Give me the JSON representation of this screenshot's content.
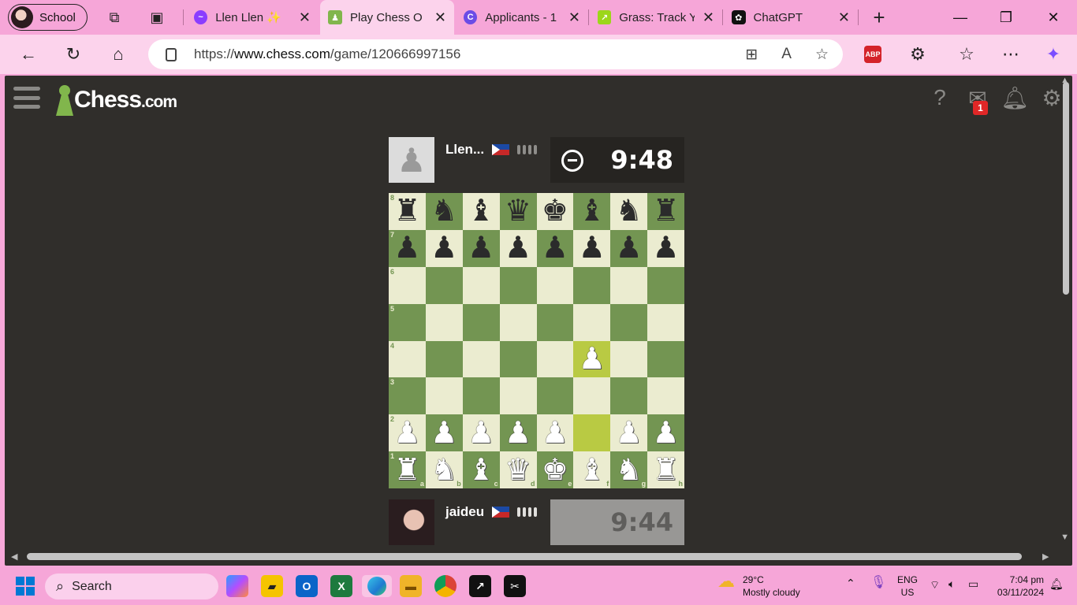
{
  "browser": {
    "profile_label": "School",
    "tabs": [
      {
        "label": "Llen Llen ✨",
        "favicon": "messenger-icon"
      },
      {
        "label": "Play Chess Online",
        "favicon": "chess-pawn-icon",
        "active": true
      },
      {
        "label": "Applicants - 1",
        "favicon": "canva-icon"
      },
      {
        "label": "Grass: Track Your",
        "favicon": "grass-icon"
      },
      {
        "label": "ChatGPT",
        "favicon": "chatgpt-icon"
      }
    ],
    "url_prefix": "https://",
    "url_host": "www.chess.com",
    "url_path": "/game/120666997156",
    "abp_label": "ABP"
  },
  "site": {
    "logo_text": "Chess",
    "logo_suffix": ".com",
    "mail_badge": "1"
  },
  "game": {
    "opponent": {
      "name": "Llen...",
      "clock": "9:48",
      "country": "Philippines"
    },
    "player": {
      "name": "jaideu",
      "clock": "9:44",
      "country": "Philippines"
    },
    "last_move": {
      "from": "f2",
      "to": "f4"
    },
    "board": [
      [
        "r",
        "n",
        "b",
        "q",
        "k",
        "b",
        "n",
        "r"
      ],
      [
        "p",
        "p",
        "p",
        "p",
        "p",
        "p",
        "p",
        "p"
      ],
      [
        "",
        "",
        "",
        "",
        "",
        "",
        "",
        ""
      ],
      [
        "",
        "",
        "",
        "",
        "",
        "",
        "",
        ""
      ],
      [
        "",
        "",
        "",
        "",
        "",
        "P",
        "",
        ""
      ],
      [
        "",
        "",
        "",
        "",
        "",
        "",
        "",
        ""
      ],
      [
        "P",
        "P",
        "P",
        "P",
        "P",
        "",
        "P",
        "P"
      ],
      [
        "R",
        "N",
        "B",
        "Q",
        "K",
        "B",
        "N",
        "R"
      ]
    ],
    "ranks": [
      "8",
      "7",
      "6",
      "5",
      "4",
      "3",
      "2",
      "1"
    ],
    "files": [
      "a",
      "b",
      "c",
      "d",
      "e",
      "f",
      "g",
      "h"
    ]
  },
  "taskbar": {
    "search_placeholder": "Search",
    "weather_temp": "29°C",
    "weather_desc": "Mostly cloudy",
    "lang_top": "ENG",
    "lang_bottom": "US",
    "time": "7:04 pm",
    "date": "03/11/2024"
  },
  "colors": {
    "board_light": "#ebecd0",
    "board_dark": "#739552",
    "highlight": "#b9ca43",
    "brand_green": "#81b64c"
  }
}
